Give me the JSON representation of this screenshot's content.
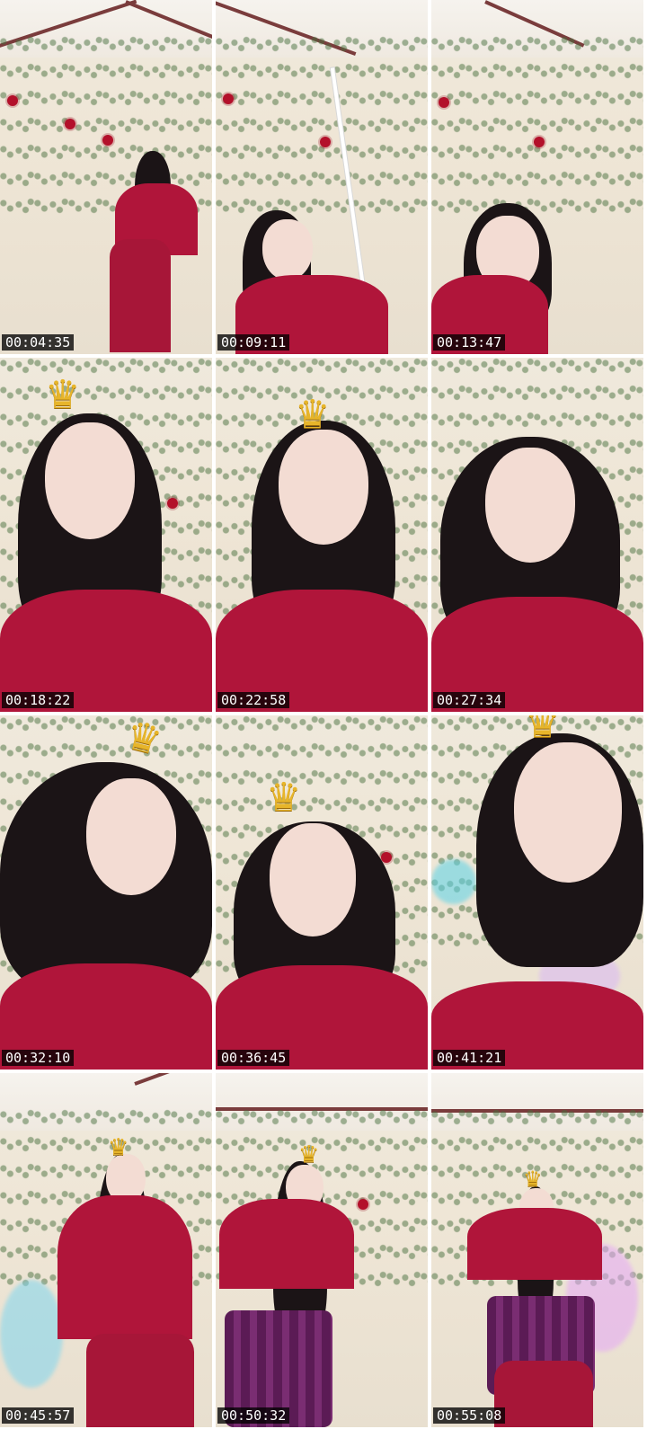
{
  "sheet": {
    "frames": [
      {
        "timestamp": "00:04:35",
        "scene": "room-wide"
      },
      {
        "timestamp": "00:09:11",
        "scene": "room-pole"
      },
      {
        "timestamp": "00:13:47",
        "scene": "closeup"
      },
      {
        "timestamp": "00:18:22",
        "scene": "crown-closeup"
      },
      {
        "timestamp": "00:22:58",
        "scene": "crown-closeup"
      },
      {
        "timestamp": "00:27:34",
        "scene": "closeup"
      },
      {
        "timestamp": "00:32:10",
        "scene": "crown-closeup"
      },
      {
        "timestamp": "00:36:45",
        "scene": "crown-closeup"
      },
      {
        "timestamp": "00:41:21",
        "scene": "crown-closeup"
      },
      {
        "timestamp": "00:45:57",
        "scene": "dance"
      },
      {
        "timestamp": "00:50:32",
        "scene": "dance"
      },
      {
        "timestamp": "00:55:08",
        "scene": "dance"
      }
    ]
  },
  "colors": {
    "shirt": "#b0153a",
    "timestamp_bg": "#000000",
    "timestamp_fg": "#ffffff",
    "crown": "#e7b52a"
  },
  "icons": {
    "crown_glyph": "♛"
  }
}
